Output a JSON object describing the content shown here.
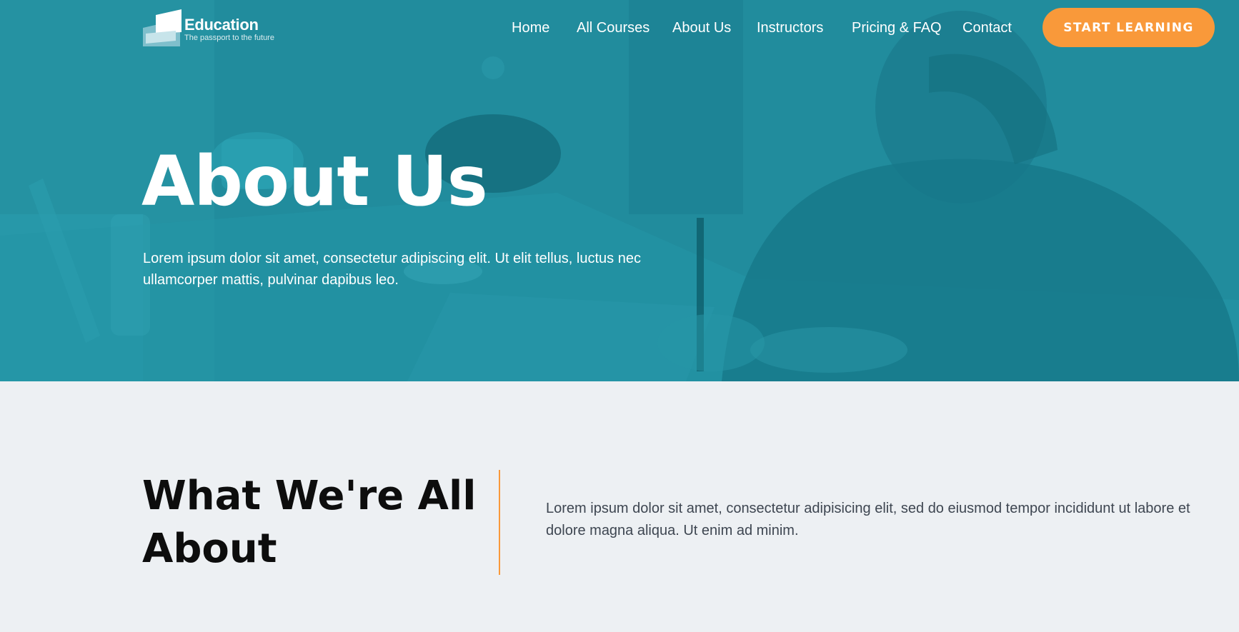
{
  "logo": {
    "title": "Education",
    "tagline": "The passport to the future"
  },
  "nav": {
    "items": [
      {
        "label": "Home"
      },
      {
        "label": "All Courses"
      },
      {
        "label": "About Us"
      },
      {
        "label": "Instructors"
      },
      {
        "label": "Pricing & FAQ"
      },
      {
        "label": "Contact"
      }
    ],
    "cta_label": "START LEARNING"
  },
  "hero": {
    "title": "About Us",
    "description": "Lorem ipsum dolor sit amet, consectetur adipiscing elit. Ut elit tellus, luctus nec ullamcorper mattis, pulvinar dapibus leo."
  },
  "about": {
    "title": "What We're All About",
    "description": "Lorem ipsum dolor sit amet, consectetur adipisicing elit, sed do eiusmod tempor incididunt ut labore et dolore magna aliqua. Ut enim ad minim."
  },
  "colors": {
    "hero_overlay": "#1f8a9c",
    "accent": "#f9993a",
    "page_bg": "#edf0f3"
  }
}
